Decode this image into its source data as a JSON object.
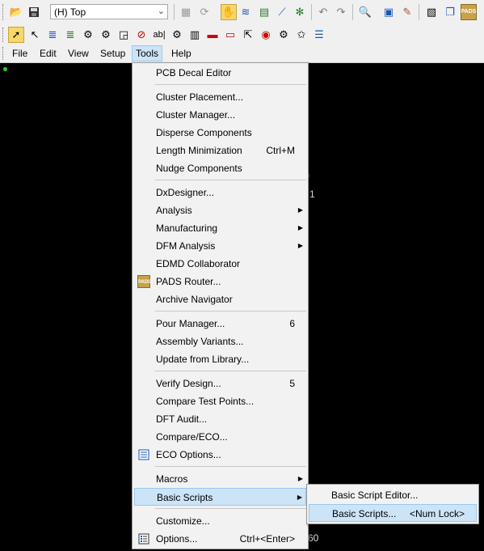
{
  "toolbar": {
    "layer_value": "(H) Top"
  },
  "menubar": {
    "items": [
      "File",
      "Edit",
      "View",
      "Setup",
      "Tools",
      "Help"
    ],
    "active": "Tools"
  },
  "tools_menu": {
    "items": [
      {
        "label": "PCB Decal Editor",
        "shortcut": ""
      },
      {
        "label": "Cluster Placement...",
        "shortcut": ""
      },
      {
        "label": "Cluster Manager...",
        "shortcut": ""
      },
      {
        "label": "Disperse Components",
        "shortcut": ""
      },
      {
        "label": "Length Minimization",
        "shortcut": "Ctrl+M"
      },
      {
        "label": "Nudge Components",
        "shortcut": ""
      },
      {
        "label": "DxDesigner...",
        "shortcut": ""
      },
      {
        "label": "Analysis",
        "shortcut": ""
      },
      {
        "label": "Manufacturing",
        "shortcut": ""
      },
      {
        "label": "DFM Analysis",
        "shortcut": ""
      },
      {
        "label": "EDMD Collaborator",
        "shortcut": ""
      },
      {
        "label": "PADS Router...",
        "shortcut": ""
      },
      {
        "label": "Archive Navigator",
        "shortcut": ""
      },
      {
        "label": "Pour Manager...",
        "shortcut": "6"
      },
      {
        "label": "Assembly Variants...",
        "shortcut": ""
      },
      {
        "label": "Update from Library...",
        "shortcut": ""
      },
      {
        "label": "Verify Design...",
        "shortcut": "5"
      },
      {
        "label": "Compare Test Points...",
        "shortcut": ""
      },
      {
        "label": "DFT Audit...",
        "shortcut": ""
      },
      {
        "label": "Compare/ECO...",
        "shortcut": ""
      },
      {
        "label": "ECO Options...",
        "shortcut": ""
      },
      {
        "label": "Macros",
        "shortcut": ""
      },
      {
        "label": "Basic Scripts",
        "shortcut": ""
      },
      {
        "label": "Customize...",
        "shortcut": ""
      },
      {
        "label": "Options...",
        "shortcut": "Ctrl+<Enter>"
      }
    ]
  },
  "basic_scripts_submenu": {
    "items": [
      {
        "label": "Basic Script Editor...",
        "shortcut": ""
      },
      {
        "label": "Basic Scripts...",
        "shortcut": "<Num Lock>"
      }
    ]
  },
  "canvas": {
    "label_1": "1",
    "label_60": "60"
  },
  "icons": {
    "pads_router_icon": "PADS",
    "toolbar_pads_icon": "PADS"
  }
}
